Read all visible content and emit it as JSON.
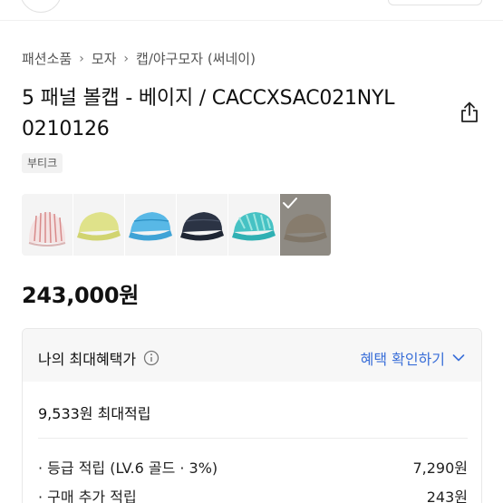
{
  "breadcrumb": [
    "패션소품",
    "모자",
    "캡/야구모자 (써네이)"
  ],
  "product": {
    "title": "5 패널 볼캡 - 베이지 / CACCXSAC021NYL 0210126",
    "tag": "부티크",
    "price": "243,000원"
  },
  "swatches": [
    {
      "color": "#f2d6d6",
      "pattern": "stripe"
    },
    {
      "color": "#dfe28a",
      "pattern": "solid"
    },
    {
      "color": "#58b8e6",
      "pattern": "solid"
    },
    {
      "color": "#2b3344",
      "pattern": "solid"
    },
    {
      "color": "#46c2c4",
      "pattern": "print"
    },
    {
      "color": "#7e6a52",
      "pattern": "solid",
      "selected": true
    }
  ],
  "benefits": {
    "title": "나의 최대혜택가",
    "check_label": "혜택 확인하기",
    "max_points": "9,533원 최대적립",
    "rows": [
      {
        "label": "· 등급 적립 (LV.6 골드 · 3%)",
        "value": "7,290원"
      },
      {
        "label": "· 구매 추가 적립",
        "value": "243원"
      }
    ]
  },
  "colors": {
    "accent": "#3a6fd8",
    "selected_overlay": "#8e8a84"
  },
  "icons": [
    "share-icon",
    "chevron-right-icon",
    "checkmark-icon",
    "info-icon",
    "chevron-down-icon"
  ]
}
